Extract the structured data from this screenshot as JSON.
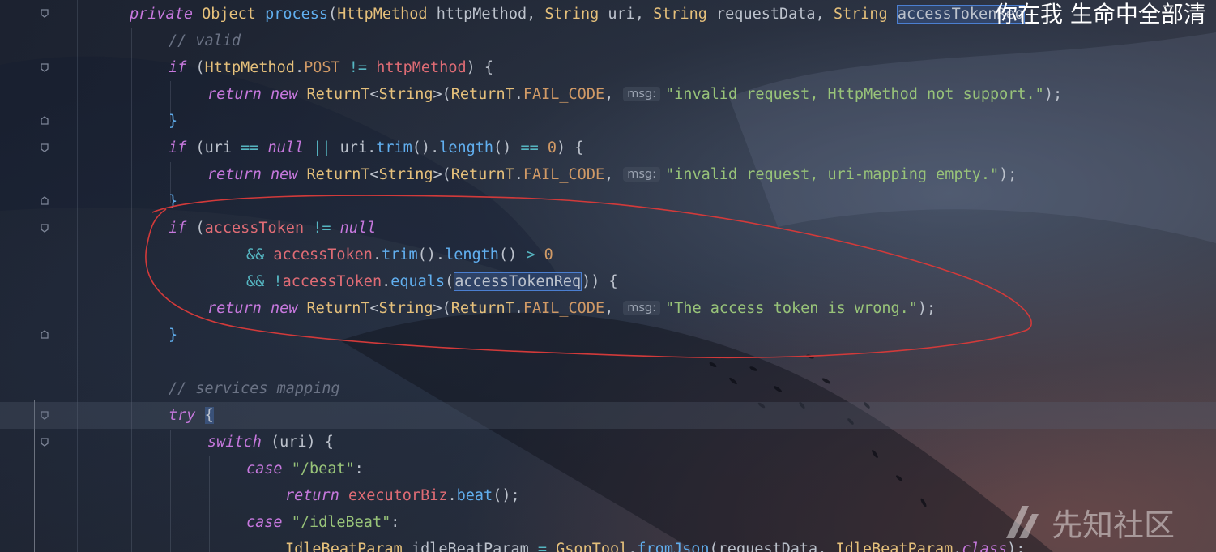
{
  "overlay_text": "你在我 生命中全部清",
  "watermark": {
    "logo_icon": "xianzhi-logo",
    "text": "先知社区"
  },
  "param_hint": "msg:",
  "code": {
    "signature": {
      "private": "private",
      "object_type": "Object",
      "method": "process",
      "param1_type": "HttpMethod",
      "param1_name": "httpMethod",
      "param2_type": "String",
      "param2_name": "uri",
      "param3_type": "String",
      "param3_name": "requestData",
      "param4_type": "String",
      "param4_name": "accessTokenReq"
    },
    "comment_valid": "// valid",
    "check_method": {
      "if": "if",
      "class": "HttpMethod",
      "const": "POST",
      "var": "httpMethod"
    },
    "return1_msg": "\"invalid request, HttpMethod not support.\"",
    "check_uri": {
      "if": "if",
      "var": "uri",
      "null": "null",
      "trim": "trim",
      "length": "length",
      "zero": "0"
    },
    "return2_msg": "\"invalid request, uri-mapping empty.\"",
    "check_token": {
      "if": "if",
      "var": "accessToken",
      "null": "null",
      "trim": "trim",
      "length": "length",
      "zero": "0",
      "equals": "equals",
      "arg": "accessTokenReq"
    },
    "return3_msg": "\"The access token is wrong.\"",
    "keywords": {
      "return": "return",
      "new": "new",
      "try": "try",
      "switch": "switch",
      "case": "case"
    },
    "returnt": {
      "class": "ReturnT",
      "generic": "String",
      "fail_code": "FAIL_CODE"
    },
    "comment_services": "// services mapping",
    "switch_var": "uri",
    "case1": "\"/beat\"",
    "case1_obj": "executorBiz",
    "case1_call": "beat",
    "case2": "\"/idleBeat\"",
    "last_line": {
      "type": "IdleBeatParam",
      "var": "idleBeatParam",
      "tool": "GsonTool",
      "method": "fromJson",
      "arg1": "requestData",
      "arg2": "IdleBeatParam",
      "class_kw": "class"
    }
  }
}
